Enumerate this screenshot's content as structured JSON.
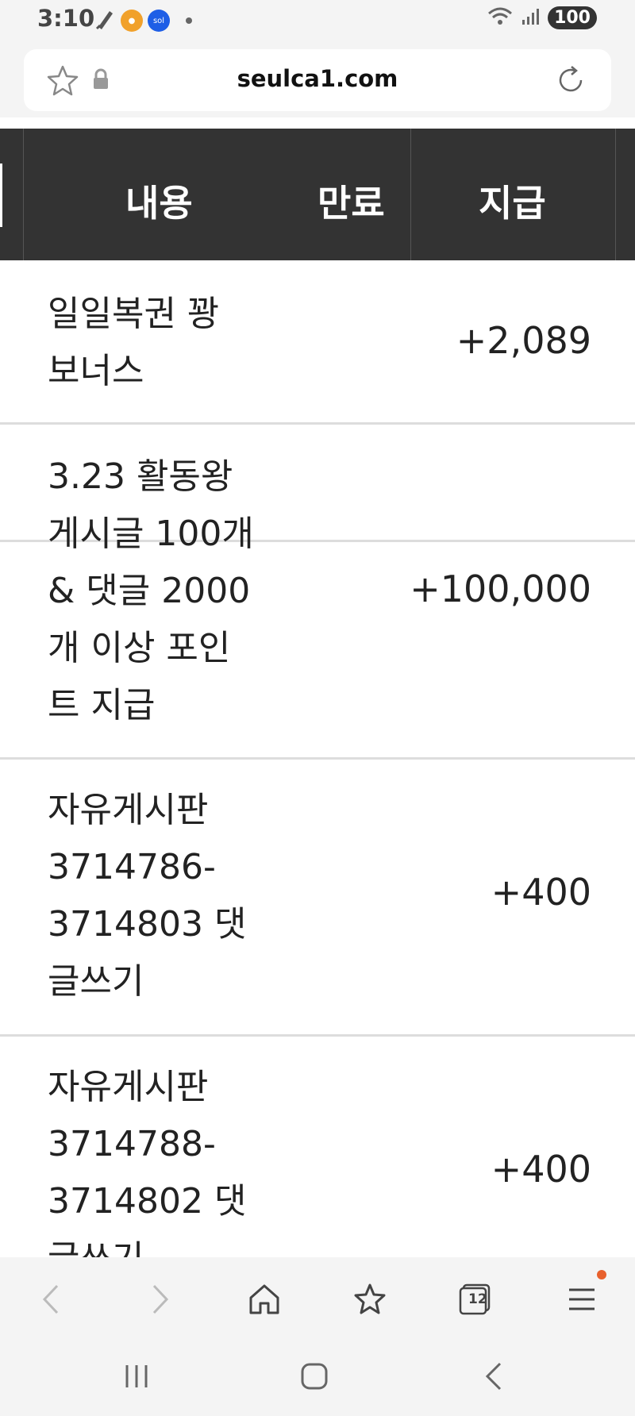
{
  "status_bar": {
    "time": "3:10",
    "battery": "100",
    "icons": [
      "pen-icon",
      "app-icon",
      "super-sol-icon",
      "notification-dot",
      "wifi-icon",
      "signal-icon"
    ]
  },
  "url_bar": {
    "url": "seulca1.com"
  },
  "table": {
    "headers": {
      "content": "내용",
      "expire": "만료",
      "payout": "지급"
    },
    "rows": [
      {
        "content": [
          "일일복권 꽝",
          "보너스"
        ],
        "amount": "+2,089"
      },
      {
        "content": [
          "3.23 활동왕",
          "게시글 100개",
          "& 댓글 2000",
          "개 이상 포인",
          "트 지급"
        ],
        "amount": "+100,000"
      },
      {
        "content": [
          "자유게시판",
          "3714786-",
          "3714803 댓",
          "글쓰기"
        ],
        "amount": "+400"
      },
      {
        "content": [
          "자유게시판",
          "3714788-",
          "3714802 댓",
          "글쓰기"
        ],
        "amount": "+400"
      }
    ]
  },
  "bottom_nav": {
    "tabs_count": "12",
    "accent_color": "#e8602c"
  }
}
